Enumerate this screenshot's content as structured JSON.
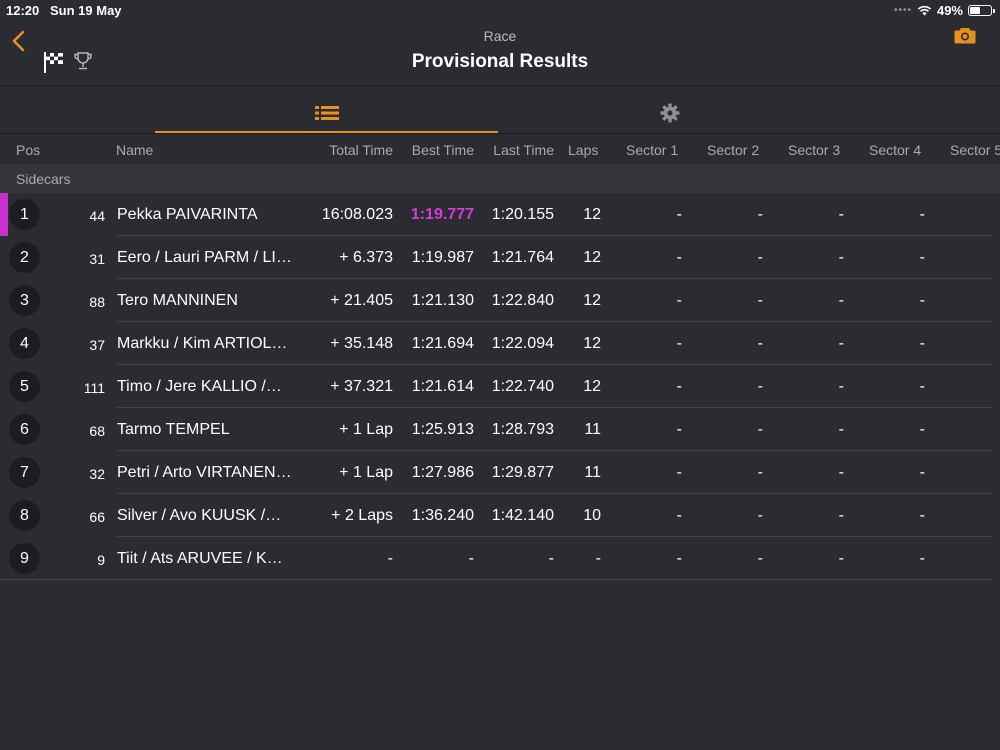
{
  "status": {
    "time": "12:20",
    "date": "Sun 19 May",
    "battery": "49%",
    "battery_level": 0.49
  },
  "nav": {
    "subtitle": "Race",
    "title": "Provisional Results"
  },
  "columns": {
    "pos": "Pos",
    "name": "Name",
    "total": "Total Time",
    "best": "Best Time",
    "last": "Last Time",
    "laps": "Laps",
    "sector1": "Sector 1",
    "sector2": "Sector 2",
    "sector3": "Sector 3",
    "sector4": "Sector 4",
    "sector5": "Sector 5"
  },
  "group": "Sidecars",
  "colors": {
    "accent": "#e8901e",
    "fastest": "#d63ad9",
    "leader": "#cc2fd0"
  },
  "rows": [
    {
      "pos": "1",
      "num": "44",
      "name": "Pekka PAIVARINTA",
      "total": "16:08.023",
      "best": "1:19.777",
      "last": "1:20.155",
      "laps": "12",
      "s1": "-",
      "s2": "-",
      "s3": "-",
      "s4": "-"
    },
    {
      "pos": "2",
      "num": "31",
      "name": "Eero / Lauri PARM / LI…",
      "total": "+ 6.373",
      "best": "1:19.987",
      "last": "1:21.764",
      "laps": "12",
      "s1": "-",
      "s2": "-",
      "s3": "-",
      "s4": "-"
    },
    {
      "pos": "3",
      "num": "88",
      "name": "Tero MANNINEN",
      "total": "+ 21.405",
      "best": "1:21.130",
      "last": "1:22.840",
      "laps": "12",
      "s1": "-",
      "s2": "-",
      "s3": "-",
      "s4": "-"
    },
    {
      "pos": "4",
      "num": "37",
      "name": "Markku / Kim ARTIOL…",
      "total": "+ 35.148",
      "best": "1:21.694",
      "last": "1:22.094",
      "laps": "12",
      "s1": "-",
      "s2": "-",
      "s3": "-",
      "s4": "-"
    },
    {
      "pos": "5",
      "num": "111",
      "name": "Timo / Jere KALLIO /…",
      "total": "+ 37.321",
      "best": "1:21.614",
      "last": "1:22.740",
      "laps": "12",
      "s1": "-",
      "s2": "-",
      "s3": "-",
      "s4": "-"
    },
    {
      "pos": "6",
      "num": "68",
      "name": "Tarmo TEMPEL",
      "total": "+ 1 Lap",
      "best": "1:25.913",
      "last": "1:28.793",
      "laps": "11",
      "s1": "-",
      "s2": "-",
      "s3": "-",
      "s4": "-"
    },
    {
      "pos": "7",
      "num": "32",
      "name": "Petri / Arto VIRTANEN…",
      "total": "+ 1 Lap",
      "best": "1:27.986",
      "last": "1:29.877",
      "laps": "11",
      "s1": "-",
      "s2": "-",
      "s3": "-",
      "s4": "-"
    },
    {
      "pos": "8",
      "num": "66",
      "name": "Silver / Avo KUUSK /…",
      "total": "+ 2 Laps",
      "best": "1:36.240",
      "last": "1:42.140",
      "laps": "10",
      "s1": "-",
      "s2": "-",
      "s3": "-",
      "s4": "-"
    },
    {
      "pos": "9",
      "num": "9",
      "name": "Tiit / Ats ARUVEE / K…",
      "total": "-",
      "best": "-",
      "last": "-",
      "laps": "-",
      "s1": "-",
      "s2": "-",
      "s3": "-",
      "s4": "-"
    }
  ]
}
